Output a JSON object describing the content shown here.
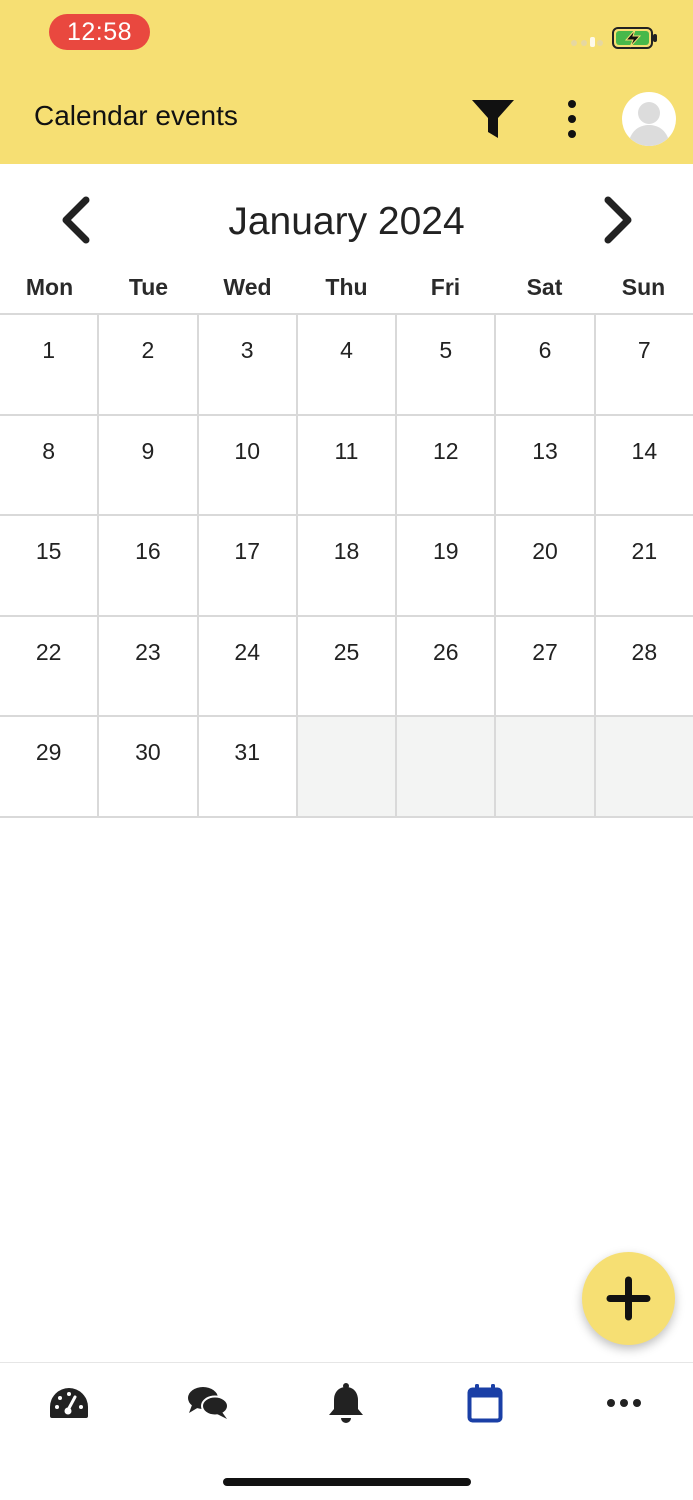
{
  "status_bar": {
    "time": "12:58"
  },
  "header": {
    "title": "Calendar events"
  },
  "calendar": {
    "month_label": "January 2024",
    "weekdays": [
      "Mon",
      "Tue",
      "Wed",
      "Thu",
      "Fri",
      "Sat",
      "Sun"
    ],
    "weeks": [
      [
        "1",
        "2",
        "3",
        "4",
        "5",
        "6",
        "7"
      ],
      [
        "8",
        "9",
        "10",
        "11",
        "12",
        "13",
        "14"
      ],
      [
        "15",
        "16",
        "17",
        "18",
        "19",
        "20",
        "21"
      ],
      [
        "22",
        "23",
        "24",
        "25",
        "26",
        "27",
        "28"
      ],
      [
        "29",
        "30",
        "31",
        "",
        "",
        "",
        ""
      ]
    ]
  },
  "bottom_nav": {
    "items": [
      "dashboard-icon",
      "chat-icon",
      "bell-icon",
      "calendar-icon",
      "more-horizontal-icon"
    ],
    "active_item": "calendar-icon",
    "active_color": "#1a3fa6"
  },
  "colors": {
    "accent": "#f6df73",
    "status_time_bg": "#e9483f"
  }
}
